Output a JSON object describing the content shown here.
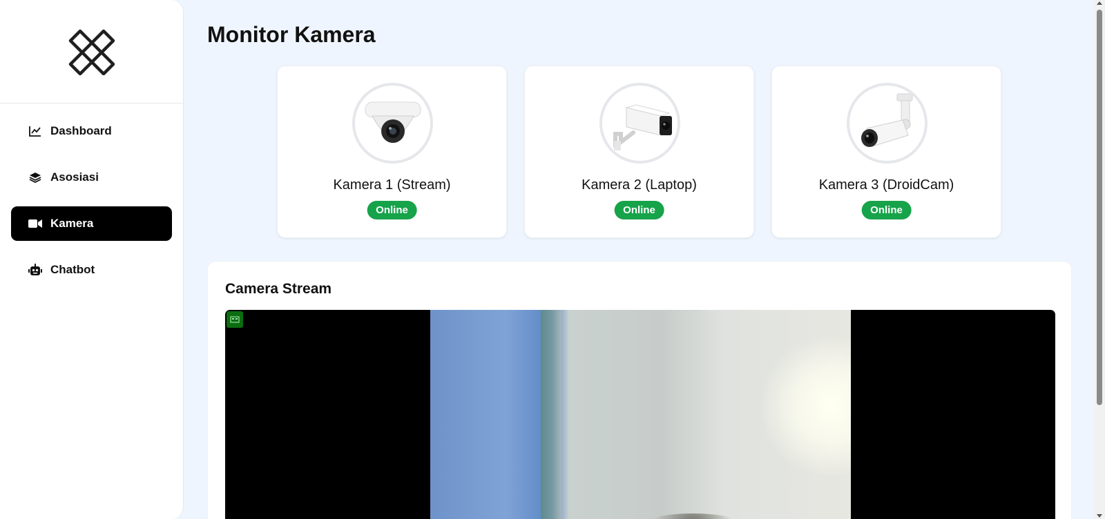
{
  "sidebar": {
    "logo": "brand-logo",
    "items": [
      {
        "label": "Dashboard",
        "icon": "chart-line-icon",
        "active": false
      },
      {
        "label": "Asosiasi",
        "icon": "layers-icon",
        "active": false
      },
      {
        "label": "Kamera",
        "icon": "video-camera-icon",
        "active": true
      },
      {
        "label": "Chatbot",
        "icon": "robot-icon",
        "active": false
      }
    ]
  },
  "main": {
    "title": "Monitor Kamera",
    "cameras": [
      {
        "name": "Kamera 1 (Stream)",
        "status": "Online",
        "image": "dome-camera-icon"
      },
      {
        "name": "Kamera 2 (Laptop)",
        "status": "Online",
        "image": "box-camera-icon"
      },
      {
        "name": "Kamera 3 (DroidCam)",
        "status": "Online",
        "image": "bullet-camera-icon"
      }
    ],
    "stream": {
      "title": "Camera Stream"
    }
  },
  "colors": {
    "accent_active": "#000000",
    "status_online": "#16a34a",
    "page_bg": "#eff5fe"
  }
}
